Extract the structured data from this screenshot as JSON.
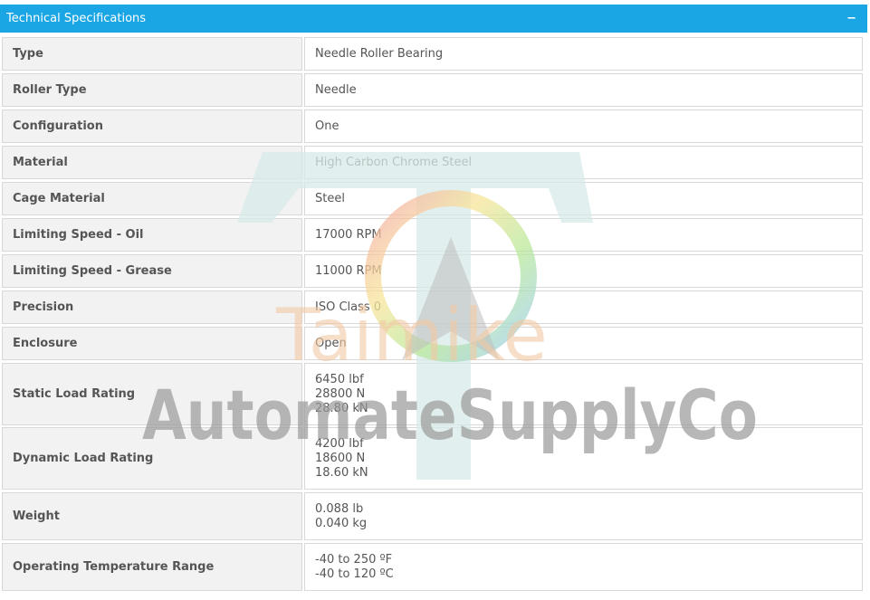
{
  "panel": {
    "title": "Technical Specifications",
    "collapse_symbol": "−"
  },
  "specs": [
    {
      "label": "Type",
      "values": [
        "Needle Roller Bearing"
      ]
    },
    {
      "label": "Roller Type",
      "values": [
        "Needle"
      ]
    },
    {
      "label": "Configuration",
      "values": [
        "One"
      ]
    },
    {
      "label": "Material",
      "values": [
        "High Carbon Chrome Steel"
      ]
    },
    {
      "label": "Cage Material",
      "values": [
        "Steel"
      ]
    },
    {
      "label": "Limiting Speed - Oil",
      "values": [
        "17000 RPM"
      ]
    },
    {
      "label": "Limiting Speed - Grease",
      "values": [
        "11000 RPM"
      ]
    },
    {
      "label": "Precision",
      "values": [
        "ISO Class 0"
      ]
    },
    {
      "label": "Enclosure",
      "values": [
        "Open"
      ]
    },
    {
      "label": "Static Load Rating",
      "values": [
        "6450 lbf",
        "28800 N",
        "28.80 kN"
      ]
    },
    {
      "label": "Dynamic Load Rating",
      "values": [
        "4200 lbf",
        "18600 N",
        "18.60 kN"
      ]
    },
    {
      "label": "Weight",
      "values": [
        "0.088 lb",
        "0.040 kg"
      ]
    },
    {
      "label": "Operating Temperature Range",
      "values": [
        "-40 to 250 ºF",
        "-40 to 120 ºC"
      ]
    }
  ],
  "watermark": {
    "brand": "Taimike",
    "company": "AutomateSupplyCo"
  },
  "colors": {
    "header_bg": "#1aa6e4",
    "label_bg": "#f2f2f2",
    "text": "#555555"
  }
}
